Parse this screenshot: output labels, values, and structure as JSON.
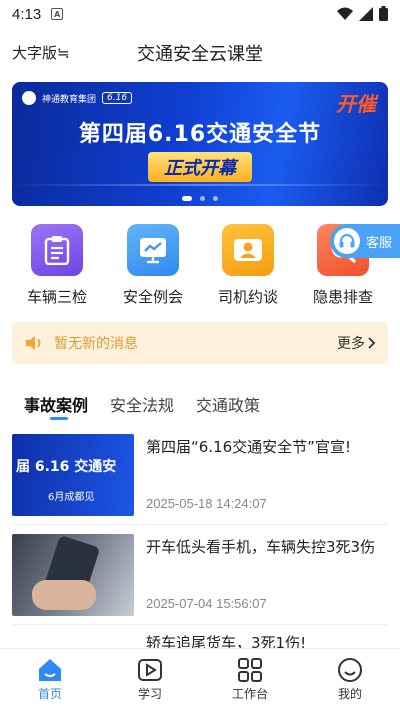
{
  "status_bar": {
    "time": "4:13",
    "indicator": "A"
  },
  "header": {
    "font_mode": "大字版",
    "font_mode_icon": "≒",
    "title": "交通安全云课堂"
  },
  "banner": {
    "brand_name": "神通教育集团",
    "brand_tag": "6.16",
    "corner_text": "开催",
    "headline": "第四届6.16交通安全节",
    "sub": "正式开幕",
    "page_count": 3,
    "active_page": 0
  },
  "quick_actions": [
    {
      "label": "车辆三检",
      "icon": "clipboard-icon",
      "color": "#8a5cf0"
    },
    {
      "label": "安全例会",
      "icon": "chart-screen-icon",
      "color": "#3d9bf2"
    },
    {
      "label": "司机约谈",
      "icon": "user-card-icon",
      "color": "#f6a21c"
    },
    {
      "label": "隐患排查",
      "icon": "search-shield-icon",
      "color": "#f56a48"
    }
  ],
  "service": {
    "label": "客服",
    "icon": "headset-icon"
  },
  "notice": {
    "message": "暂无新的消息",
    "more": "更多",
    "icon": "speaker-icon"
  },
  "tabs": [
    {
      "label": "事故案例",
      "active": true
    },
    {
      "label": "安全法规",
      "active": false
    },
    {
      "label": "交通政策",
      "active": false
    }
  ],
  "news": [
    {
      "title": "第四届“6.16交通安全节”官宣!",
      "time": "2025-05-18 14:24:07",
      "thumb_text": "届 6.16 交通安",
      "thumb_sub": "6月成都见"
    },
    {
      "title": "开车低头看手机，车辆失控3死3伤",
      "time": "2025-07-04 15:56:07"
    },
    {
      "title": "轿车追尾货车，3死1伤!"
    }
  ],
  "bottom_nav": [
    {
      "label": "首页",
      "icon": "home-icon",
      "active": true
    },
    {
      "label": "学习",
      "icon": "play-icon",
      "active": false
    },
    {
      "label": "工作台",
      "icon": "grid-icon",
      "active": false
    },
    {
      "label": "我的",
      "icon": "smile-icon",
      "active": false
    }
  ],
  "colors": {
    "accent": "#2f8af5",
    "notice_bg": "#fdf1dc",
    "notice_text": "#e39b2f"
  }
}
